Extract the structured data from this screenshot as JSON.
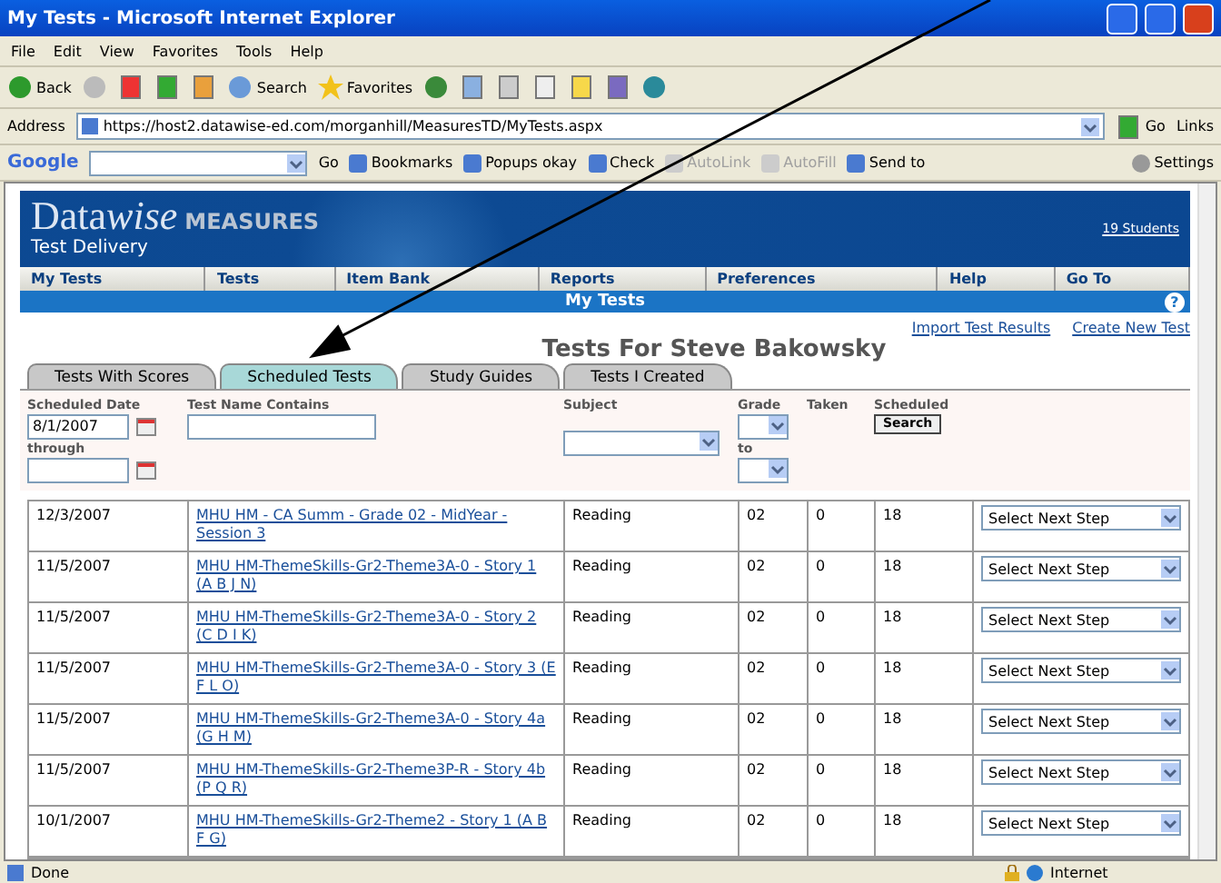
{
  "window": {
    "title": "My Tests - Microsoft Internet Explorer"
  },
  "menu": [
    "File",
    "Edit",
    "View",
    "Favorites",
    "Tools",
    "Help"
  ],
  "toolbar": {
    "back": "Back",
    "search": "Search",
    "favorites": "Favorites"
  },
  "address": {
    "label": "Address",
    "url": "https://host2.datawise-ed.com/morganhill/MeasuresTD/MyTests.aspx",
    "go": "Go",
    "links": "Links"
  },
  "google_bar": {
    "logo": "Google",
    "go": "Go",
    "items": [
      {
        "label": "Bookmarks",
        "disabled": false
      },
      {
        "label": "Popups okay",
        "disabled": false
      },
      {
        "label": "Check",
        "disabled": false
      },
      {
        "label": "AutoLink",
        "disabled": true
      },
      {
        "label": "AutoFill",
        "disabled": true
      },
      {
        "label": "Send to",
        "disabled": false
      }
    ],
    "settings": "Settings"
  },
  "banner": {
    "logo": "Data",
    "logo_italic": "wise",
    "logo_suffix": "MEASURES",
    "subtitle": "Test Delivery",
    "students": "19 Students"
  },
  "nav": [
    "My Tests",
    "Tests",
    "Item Bank",
    "Reports",
    "Preferences",
    "Help",
    "Go To"
  ],
  "section": {
    "title": "My Tests",
    "help": "?"
  },
  "links": [
    "Import Test Results",
    "Create New Test"
  ],
  "heading": "Tests For Steve Bakowsky",
  "tabs": [
    {
      "label": "Tests With Scores",
      "selected": false
    },
    {
      "label": "Scheduled Tests",
      "selected": true
    },
    {
      "label": "Study Guides",
      "selected": false
    },
    {
      "label": "Tests I Created",
      "selected": false
    }
  ],
  "filters": {
    "scheduled_date": "Scheduled Date",
    "date_from": "8/1/2007",
    "through": "through",
    "test_name": "Test Name Contains",
    "subject": "Subject",
    "grade": "Grade",
    "to": "to",
    "taken": "Taken",
    "scheduled": "Scheduled",
    "search": "Search"
  },
  "rows": [
    {
      "date": "12/3/2007",
      "name": "MHU HM - CA Summ - Grade 02 - MidYear - Session 3",
      "subject": "Reading",
      "grade": "02",
      "taken": "0",
      "scheduled": "18",
      "step": "Select Next Step"
    },
    {
      "date": "11/5/2007",
      "name": "MHU HM-ThemeSkills-Gr2-Theme3A-0 - Story 1 (A B J N)",
      "subject": "Reading",
      "grade": "02",
      "taken": "0",
      "scheduled": "18",
      "step": "Select Next Step"
    },
    {
      "date": "11/5/2007",
      "name": "MHU HM-ThemeSkills-Gr2-Theme3A-0 - Story 2 (C D I K)",
      "subject": "Reading",
      "grade": "02",
      "taken": "0",
      "scheduled": "18",
      "step": "Select Next Step"
    },
    {
      "date": "11/5/2007",
      "name": "MHU HM-ThemeSkills-Gr2-Theme3A-0 - Story 3 (E F L O)",
      "subject": "Reading",
      "grade": "02",
      "taken": "0",
      "scheduled": "18",
      "step": "Select Next Step"
    },
    {
      "date": "11/5/2007",
      "name": "MHU HM-ThemeSkills-Gr2-Theme3A-0 - Story 4a (G H M)",
      "subject": "Reading",
      "grade": "02",
      "taken": "0",
      "scheduled": "18",
      "step": "Select Next Step"
    },
    {
      "date": "11/5/2007",
      "name": "MHU HM-ThemeSkills-Gr2-Theme3P-R - Story 4b (P Q R)",
      "subject": "Reading",
      "grade": "02",
      "taken": "0",
      "scheduled": "18",
      "step": "Select Next Step"
    },
    {
      "date": "10/1/2007",
      "name": "MHU HM-ThemeSkills-Gr2-Theme2 - Story 1 (A B F G)",
      "subject": "Reading",
      "grade": "02",
      "taken": "0",
      "scheduled": "18",
      "step": "Select Next Step"
    }
  ],
  "status_bar": {
    "text": "Done",
    "zone": "Internet"
  }
}
